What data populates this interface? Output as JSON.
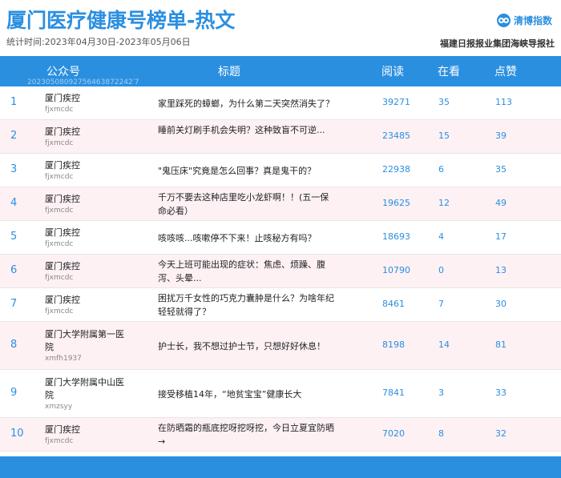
{
  "header": {
    "title": "厦门医疗健康号榜单-热文",
    "period": "统计时间:2023年04月30日-2023年05月06日",
    "brand_name": "清博指数",
    "publisher": "福建日报报业集团海峡导报社"
  },
  "table": {
    "columns": {
      "account": "公众号",
      "title": "标题",
      "reads": "阅读",
      "watching": "在看",
      "likes": "点赞"
    },
    "watermark": "20230508092756463872242′7",
    "rows": [
      {
        "rank": "1",
        "account": "厦门疾控",
        "account_id": "fjxmcdc",
        "title": "家里踩死的蟑螂，为什么第二天突然消失了？",
        "reads": "39271",
        "watching": "35",
        "likes": "113"
      },
      {
        "rank": "2",
        "account": "厦门疾控",
        "account_id": "fjxmcdc",
        "title": "睡前关灯刷手机会失明？这种致盲不可逆...",
        "reads": "23485",
        "watching": "15",
        "likes": "39"
      },
      {
        "rank": "3",
        "account": "厦门疾控",
        "account_id": "fjxmcdc",
        "title": "\"鬼压床\"究竟是怎么回事？真是鬼干的？",
        "reads": "22938",
        "watching": "6",
        "likes": "35"
      },
      {
        "rank": "4",
        "account": "厦门疾控",
        "account_id": "fjxmcdc",
        "title": "千万不要去这种店里吃小龙虾啊！！(五一保命必看）",
        "reads": "19625",
        "watching": "12",
        "likes": "49"
      },
      {
        "rank": "5",
        "account": "厦门疾控",
        "account_id": "fjxmcdc",
        "title": "咳咳咳...咳嗽停不下来！止咳秘方有吗？",
        "reads": "18693",
        "watching": "4",
        "likes": "17"
      },
      {
        "rank": "6",
        "account": "厦门疾控",
        "account_id": "fjxmcdc",
        "title": "今天上班可能出现的症状：焦虑、烦躁、腹泻、头晕...",
        "reads": "10790",
        "watching": "0",
        "likes": "13"
      },
      {
        "rank": "7",
        "account": "厦门疾控",
        "account_id": "fjxmcdc",
        "title": "困扰万千女性的巧克力囊肿是什么？为啥年纪轻轻就得了？",
        "reads": "8461",
        "watching": "7",
        "likes": "30"
      },
      {
        "rank": "8",
        "account": "厦门大学附属第一医院",
        "account_id": "xmfh1937",
        "title": "护士长，我不想过护士节，只想好好休息！",
        "reads": "8198",
        "watching": "14",
        "likes": "81"
      },
      {
        "rank": "9",
        "account": "厦门大学附属中山医院",
        "account_id": "xmzsyy",
        "title": "接受移植14年，“地贫宝宝”健康长大",
        "reads": "7841",
        "watching": "3",
        "likes": "33"
      },
      {
        "rank": "10",
        "account": "厦门疾控",
        "account_id": "fjxmcdc",
        "title": "在防晒霜的瓶底挖呀挖呀挖，今日立夏宜防晒→",
        "reads": "7020",
        "watching": "8",
        "likes": "32"
      }
    ]
  },
  "colors": {
    "accent": "#2b8fe0",
    "row_alt": "#fdf1f4"
  }
}
